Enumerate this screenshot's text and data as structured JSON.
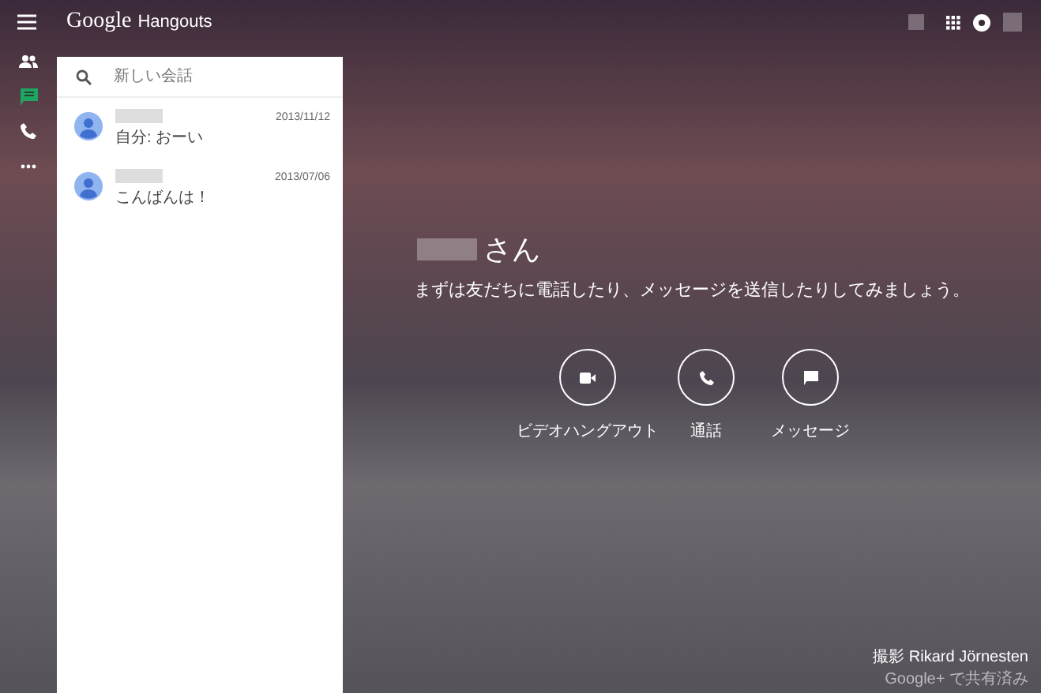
{
  "app": {
    "brand": "Google",
    "title": "Hangouts"
  },
  "nav": [
    {
      "kind": "contacts",
      "selected": false
    },
    {
      "kind": "chat",
      "selected": true
    },
    {
      "kind": "phone",
      "selected": false
    },
    {
      "kind": "more",
      "selected": false
    }
  ],
  "search": {
    "placeholder": "新しい会話"
  },
  "conversations": [
    {
      "time": "2013/11/12",
      "snippet": "自分: おーい"
    },
    {
      "time": "2013/07/06",
      "snippet": "こんばんは！"
    }
  ],
  "greeting": {
    "suffix": "さん",
    "message": "まずは友だちに電話したり、メッセージを送信したりしてみましょう。"
  },
  "actions": [
    {
      "kind": "video",
      "label": "ビデオハングアウト"
    },
    {
      "kind": "call",
      "label": "通話"
    },
    {
      "kind": "message",
      "label": "メッセージ"
    }
  ],
  "credit": {
    "photo": "撮影 Rikard Jörnesten",
    "shared": "Google+ で共有済み"
  }
}
